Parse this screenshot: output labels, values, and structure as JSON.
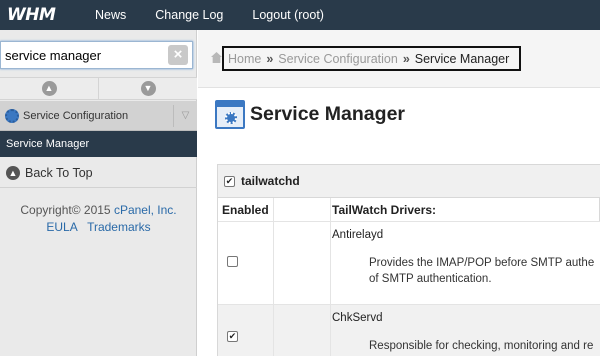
{
  "topbar": {
    "logo": "WHM",
    "nav": [
      "News",
      "Change Log",
      "Logout (root)"
    ]
  },
  "sidebar": {
    "search_value": "service manager",
    "clear_icon": "close-icon",
    "section_label": "Service Configuration",
    "active_item": "Service Manager",
    "back_to_top": "Back To Top",
    "copyright_prefix": "Copyright© 2015",
    "copyright_link": "cPanel, Inc.",
    "links": [
      "EULA",
      "Trademarks"
    ]
  },
  "breadcrumb": {
    "items": [
      "Home",
      "Service Configuration"
    ],
    "separator": "»",
    "current": "Service Manager"
  },
  "page": {
    "title": "Service Manager"
  },
  "panel": {
    "title": "tailwatchd",
    "checked": true,
    "columns": {
      "enabled": "Enabled",
      "drivers": "TailWatch Drivers:"
    },
    "rows": [
      {
        "name": "Antirelayd",
        "checked": false,
        "desc_line1": "Provides the IMAP/POP before SMTP authe",
        "desc_line2": "of SMTP authentication."
      },
      {
        "name": "ChkServd",
        "checked": true,
        "desc_line1": "Responsible for checking, monitoring and re"
      }
    ]
  },
  "colors": {
    "topbar_bg": "#293a4a",
    "active_item_bg": "#293a4a",
    "link": "#2a6aa8",
    "accent_icon": "#3b78c2"
  }
}
